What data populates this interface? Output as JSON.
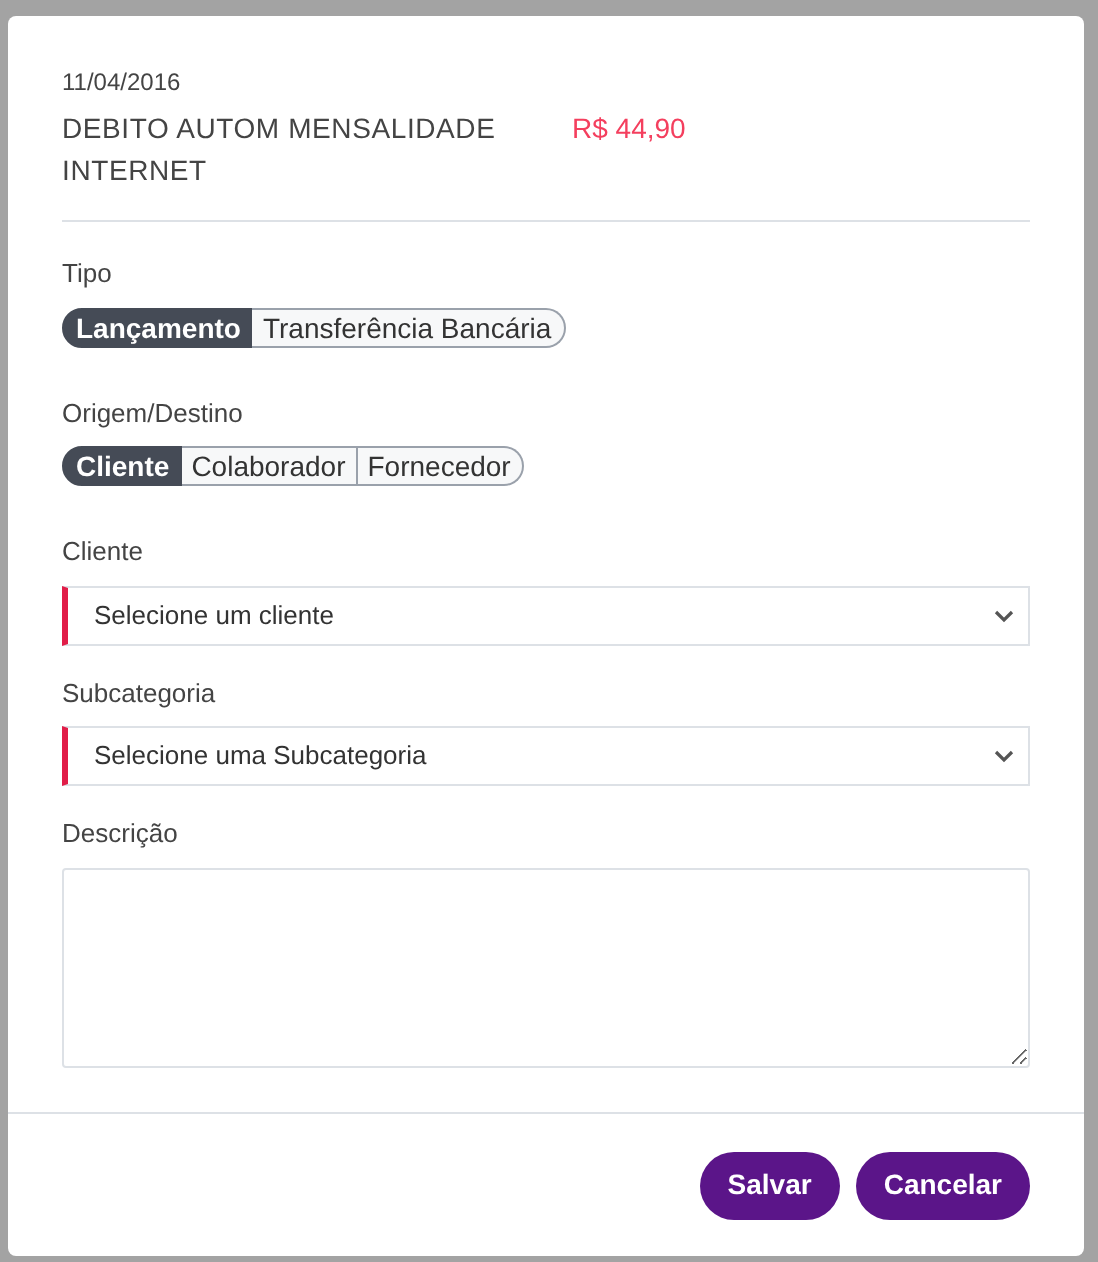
{
  "transaction": {
    "date": "11/04/2016",
    "description": "DEBITO AUTOM MENSALIDADE INTERNET",
    "amount": "R$ 44,90"
  },
  "form": [
    {
      "kind": "toggle",
      "label": "Tipo",
      "options": [
        {
          "label": "Lançamento",
          "selected": true
        },
        {
          "label": "Transferência Bancária",
          "selected": false
        }
      ]
    },
    {
      "kind": "toggle",
      "label": "Origem/Destino",
      "options": [
        {
          "label": "Cliente",
          "selected": true
        },
        {
          "label": "Colaborador",
          "selected": false
        },
        {
          "label": "Fornecedor",
          "selected": false
        }
      ]
    },
    {
      "kind": "select",
      "label": "Cliente",
      "placeholder": "Selecione um cliente",
      "required": true
    },
    {
      "kind": "select",
      "label": "Subcategoria",
      "placeholder": "Selecione uma Subcategoria",
      "required": true
    },
    {
      "kind": "textarea",
      "label": "Descrição"
    }
  ],
  "buttons": [
    "Salvar",
    "Cancelar"
  ]
}
